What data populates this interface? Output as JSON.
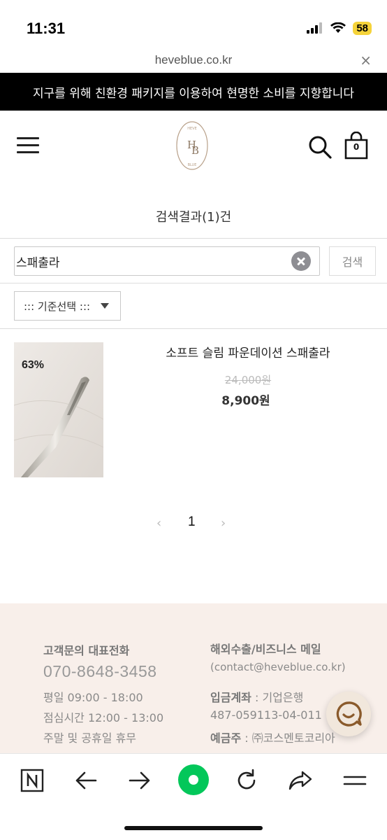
{
  "status_bar": {
    "time": "11:31",
    "battery": "58"
  },
  "browser": {
    "url": "heveblue.co.kr",
    "close_symbol": "×"
  },
  "banner": {
    "text": "지구를 위해 친환경 패키지를 이용하여 현명한 소비를 지향합니다"
  },
  "header": {
    "cart_count": "0",
    "logo_icon": "heveblue-logo-icon"
  },
  "search": {
    "result_prefix": "검색결과(",
    "result_count": "1",
    "result_suffix": ")건",
    "query": "스패출라",
    "button_label": "검색",
    "sort_label": "::: 기준선택 :::"
  },
  "products": [
    {
      "name": "소프트 슬림 파운데이션 스패출라",
      "original_price": "24,000원",
      "sale_price": "8,900원",
      "discount": "63%"
    }
  ],
  "pagination": {
    "prev": "‹",
    "current": "1",
    "next": "›"
  },
  "footer": {
    "cs_title": "고객문의 대표전화",
    "phone": "070-8648-3458",
    "weekday_hours": "평일 09:00 - 18:00",
    "lunch_hours": "점심시간 12:00 - 13:00",
    "holiday": "주말 및 공휴일 휴무",
    "export_title": "해외수출/비즈니스 메일",
    "email": "(contact@heveblue.co.kr)",
    "bank_label": "입금계좌",
    "bank_name": " : 기업은행",
    "account_number": "487-059113-04-011",
    "holder_label": "예금주",
    "holder_name": " : ㈜코스멘토코리아"
  },
  "toolbar": {
    "icons": [
      "naver-n-icon",
      "back-arrow-icon",
      "forward-arrow-icon",
      "green-dot-home-icon",
      "refresh-icon",
      "share-icon",
      "menu-lines-icon"
    ]
  },
  "colors": {
    "banner_bg": "#000000",
    "footer_bg": "#f8efea",
    "accent_green": "#03c75a",
    "battery": "#f5d33a"
  }
}
